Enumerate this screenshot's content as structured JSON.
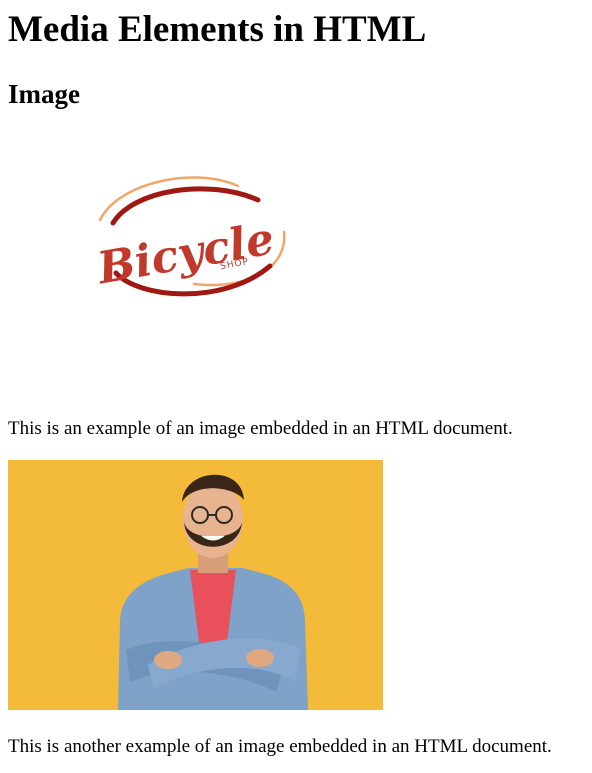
{
  "page": {
    "heading": "Media Elements in HTML",
    "subheading": "Image"
  },
  "logo": {
    "text": "Bicycle",
    "subtext": "SHOP",
    "colors": {
      "ring_dark": "#a01812",
      "ring_light": "#f2a66a",
      "text": "#c0392b"
    }
  },
  "captions": {
    "first": "This is an example of an image embedded in an HTML document.",
    "second": "This is another example of an image embedded in an HTML document."
  },
  "photo": {
    "subject": "man-in-denim-jacket-with-crossed-arms",
    "colors": {
      "background": "#f4ba3a",
      "jacket": "#7fa3c8",
      "shirt": "#e8505b",
      "skin": "#e8b48f",
      "hair": "#3a2519"
    }
  }
}
